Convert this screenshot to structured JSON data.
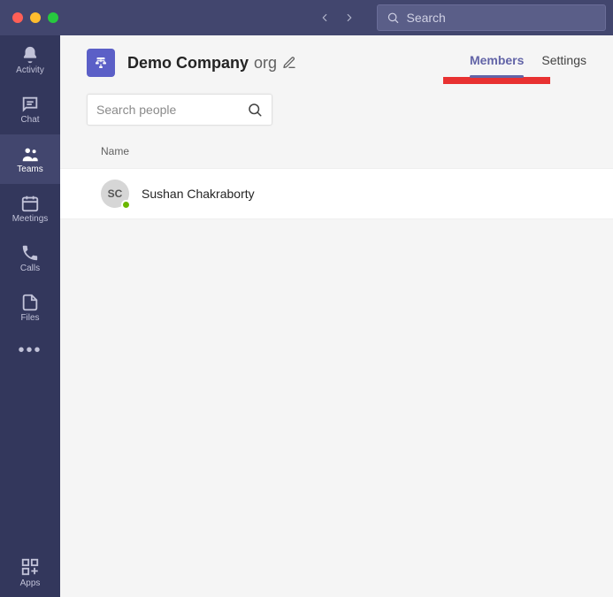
{
  "search": {
    "placeholder": "Search"
  },
  "rail": {
    "activity": "Activity",
    "chat": "Chat",
    "teams": "Teams",
    "meetings": "Meetings",
    "calls": "Calls",
    "files": "Files",
    "apps": "Apps"
  },
  "org": {
    "name": "Demo Company",
    "suffix": "org"
  },
  "tabs": {
    "members": "Members",
    "settings": "Settings"
  },
  "searchPeople": {
    "placeholder": "Search people"
  },
  "columns": {
    "name": "Name"
  },
  "members": [
    {
      "initials": "SC",
      "name": "Sushan Chakraborty",
      "presence": "available"
    }
  ]
}
